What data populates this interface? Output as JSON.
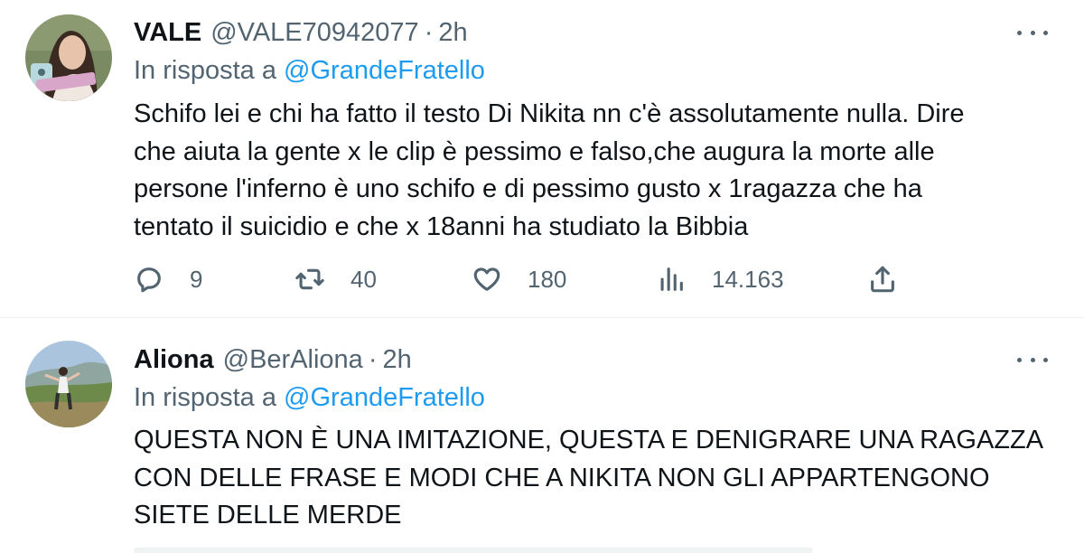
{
  "tweets": [
    {
      "name": "VALE",
      "handle": "@VALE70942077",
      "separator": "·",
      "time": "2h",
      "reply_prefix": "In risposta a",
      "reply_mention": "@GrandeFratello",
      "text_lines": [
        "Schifo lei e chi ha fatto il testo Di Nikita nn c'è assolutamente nulla. Dire",
        "che aiuta la gente x le clip è pessimo e falso,che augura la morte alle",
        "persone l'inferno è uno schifo e di pessimo gusto x 1ragazza che ha",
        "tentato il suicidio e che x 18anni ha studiato la Bibbia"
      ],
      "stats": {
        "replies": "9",
        "retweets": "40",
        "likes": "180",
        "views": "14.163"
      }
    },
    {
      "name": "Aliona",
      "handle": "@BerAliona",
      "separator": "·",
      "time": "2h",
      "reply_prefix": "In risposta a",
      "reply_mention": "@GrandeFratello",
      "text_lines": [
        "QUESTA NON È UNA IMITAZIONE, QUESTA E DENIGRARE UNA RAGAZZA",
        "CON DELLE FRASE E MODI CHE A NIKITA NON GLI APPARTENGONO",
        "SIETE DELLE MERDE"
      ]
    }
  ],
  "icons": {
    "reply": "reply-icon",
    "retweet": "retweet-icon",
    "like": "heart-icon",
    "views": "views-icon",
    "share": "share-icon",
    "more": "more-icon"
  },
  "colors": {
    "text": "#0f1419",
    "secondary": "#536471",
    "mention": "#1d9bf0",
    "divider": "#eff3f4"
  }
}
